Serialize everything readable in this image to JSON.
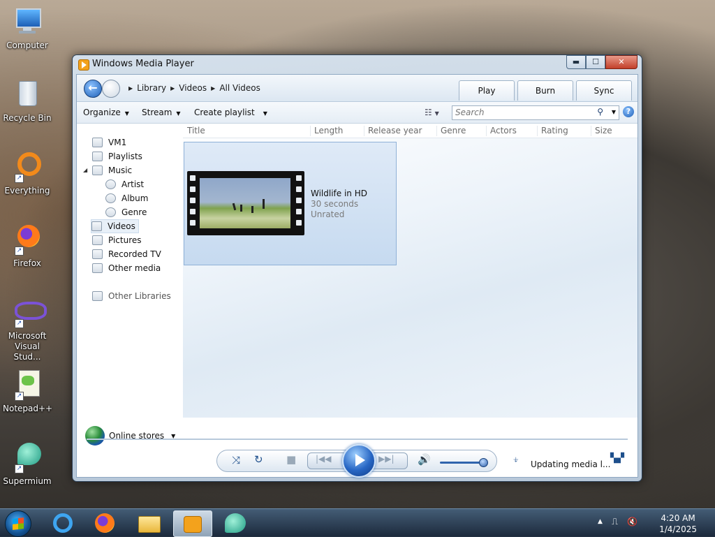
{
  "desktop": {
    "icons": [
      {
        "label": "Computer"
      },
      {
        "label": "Recycle Bin"
      },
      {
        "label": "Everything"
      },
      {
        "label": "Firefox"
      },
      {
        "label": "Microsoft Visual Stud..."
      },
      {
        "label": "Notepad++"
      },
      {
        "label": "Supermium"
      }
    ]
  },
  "window": {
    "title": "Windows Media Player",
    "controls": {
      "minimize": "▬",
      "maximize": "☐",
      "close": "✕"
    }
  },
  "nav": {
    "breadcrumb": [
      "Library",
      "Videos",
      "All Videos"
    ],
    "tabs": [
      "Play",
      "Burn",
      "Sync"
    ]
  },
  "toolbar": {
    "organize": "Organize",
    "stream": "Stream",
    "create_playlist": "Create playlist",
    "search_placeholder": "Search"
  },
  "sidebar": {
    "items": [
      {
        "label": "VM1"
      },
      {
        "label": "Playlists"
      },
      {
        "label": "Music"
      },
      {
        "label": "Artist"
      },
      {
        "label": "Album"
      },
      {
        "label": "Genre"
      },
      {
        "label": "Videos"
      },
      {
        "label": "Pictures"
      },
      {
        "label": "Recorded TV"
      },
      {
        "label": "Other media"
      },
      {
        "label": "Other Libraries"
      }
    ],
    "selected": "Videos",
    "online_stores": "Online stores"
  },
  "columns": [
    "Title",
    "Length",
    "Release year",
    "Genre",
    "Actors",
    "Rating",
    "Size"
  ],
  "media": {
    "title": "Wildlife in HD",
    "length": "30 seconds",
    "rating": "Unrated"
  },
  "player": {
    "status": "Updating media l..."
  },
  "taskbar": {
    "apps": [
      "internet-explorer-icon",
      "firefox-icon",
      "file-explorer-icon",
      "windows-media-player-icon",
      "supermium-icon"
    ],
    "time": "4:20 AM",
    "date": "1/4/2025"
  }
}
